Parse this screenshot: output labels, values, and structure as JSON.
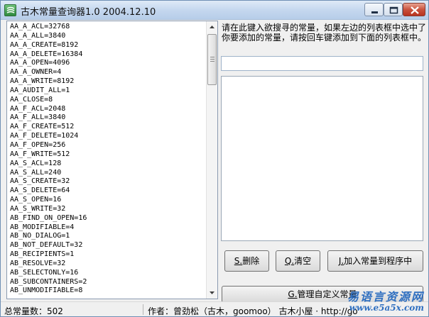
{
  "window": {
    "title": "古木常量查询器1.0   2004.12.10",
    "icon": "app-icon"
  },
  "constants": [
    "AA_A_ACL=32768",
    "AA_A_ALL=3840",
    "AA_A_CREATE=8192",
    "AA_A_DELETE=16384",
    "AA_A_OPEN=4096",
    "AA_A_OWNER=4",
    "AA_A_WRITE=8192",
    "AA_AUDIT_ALL=1",
    "AA_CLOSE=8",
    "AA_F_ACL=2048",
    "AA_F_ALL=3840",
    "AA_F_CREATE=512",
    "AA_F_DELETE=1024",
    "AA_F_OPEN=256",
    "AA_F_WRITE=512",
    "AA_S_ACL=128",
    "AA_S_ALL=240",
    "AA_S_CREATE=32",
    "AA_S_DELETE=64",
    "AA_S_OPEN=16",
    "AA_S_WRITE=32",
    "AB_FIND_ON_OPEN=16",
    "AB_MODIFIABLE=4",
    "AB_NO_DIALOG=1",
    "AB_NOT_DEFAULT=32",
    "AB_RECIPIENTS=1",
    "AB_RESOLVE=32",
    "AB_SELECTONLY=16",
    "AB_SUBCONTAINERS=2",
    "AB_UNMODIFIABLE=8"
  ],
  "hint": "请在此键入欲搜寻的常量，如果左边的列表框中选中了你要添加的常量，请按回车键添加到下面的列表框中。",
  "search": {
    "value": "",
    "placeholder": ""
  },
  "buttons": {
    "delete": {
      "key": "S.",
      "label": "删除"
    },
    "clear": {
      "key": "Q.",
      "label": "清空"
    },
    "add": {
      "key": "J.",
      "label": "加入常量到程序中"
    },
    "manage": {
      "key": "G.",
      "label": "管理自定义常量"
    }
  },
  "status": {
    "count_label": "总常量数：",
    "count": "502",
    "author": "作者：曾劲松（古木，goomoo）  古木小屋 · http://go"
  },
  "watermark": {
    "title": "易语言资源网",
    "url": "www.e5a5x.com"
  },
  "colors": {
    "title_bar": "#c3d6ee",
    "close_button": "#c9523d",
    "window_bg": "#f0f0f0",
    "watermark": "#2f6fc0"
  }
}
